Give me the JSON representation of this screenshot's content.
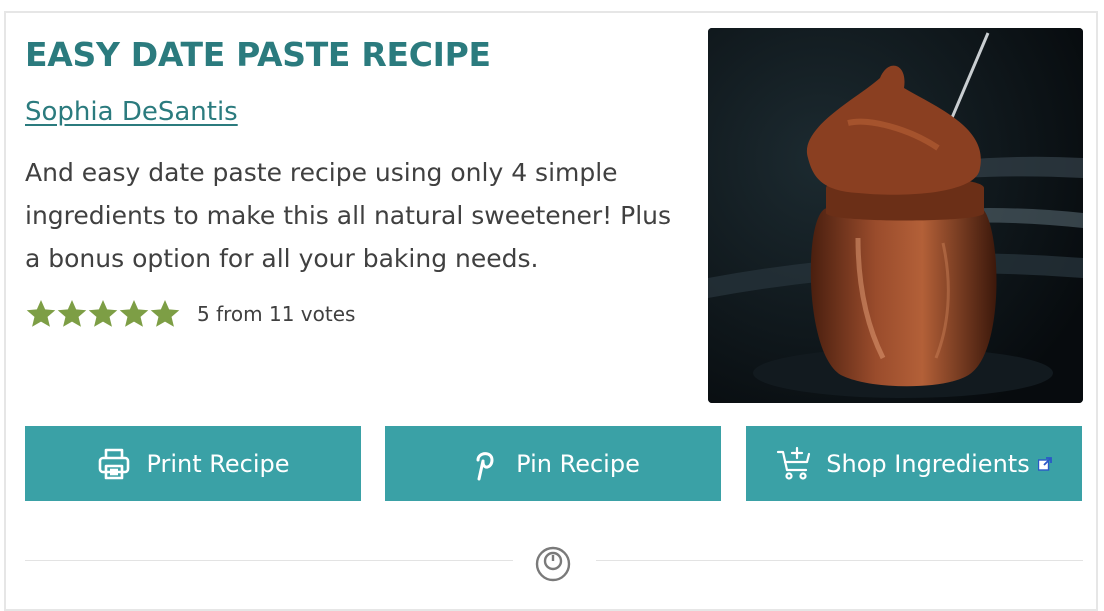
{
  "recipe": {
    "title": "EASY DATE PASTE RECIPE",
    "author": "Sophia DeSantis",
    "description": "And easy date paste recipe using only 4 simple ingredients to make this all natural sweetener! Plus a bonus option for all your baking needs.",
    "rating": {
      "stars": 5,
      "max_stars": 5,
      "text": "5 from 11 votes"
    }
  },
  "buttons": {
    "print": "Print Recipe",
    "pin": "Pin Recipe",
    "shop": "Shop Ingredients"
  },
  "icons": {
    "print": "printer-icon",
    "pin": "pinterest-icon",
    "shop": "cart-plus-icon",
    "external": "external-link-icon",
    "divider": "timer-icon"
  },
  "colors": {
    "accent": "#2b7b7e",
    "button": "#3aa1a6",
    "star": "#7d9e45"
  }
}
